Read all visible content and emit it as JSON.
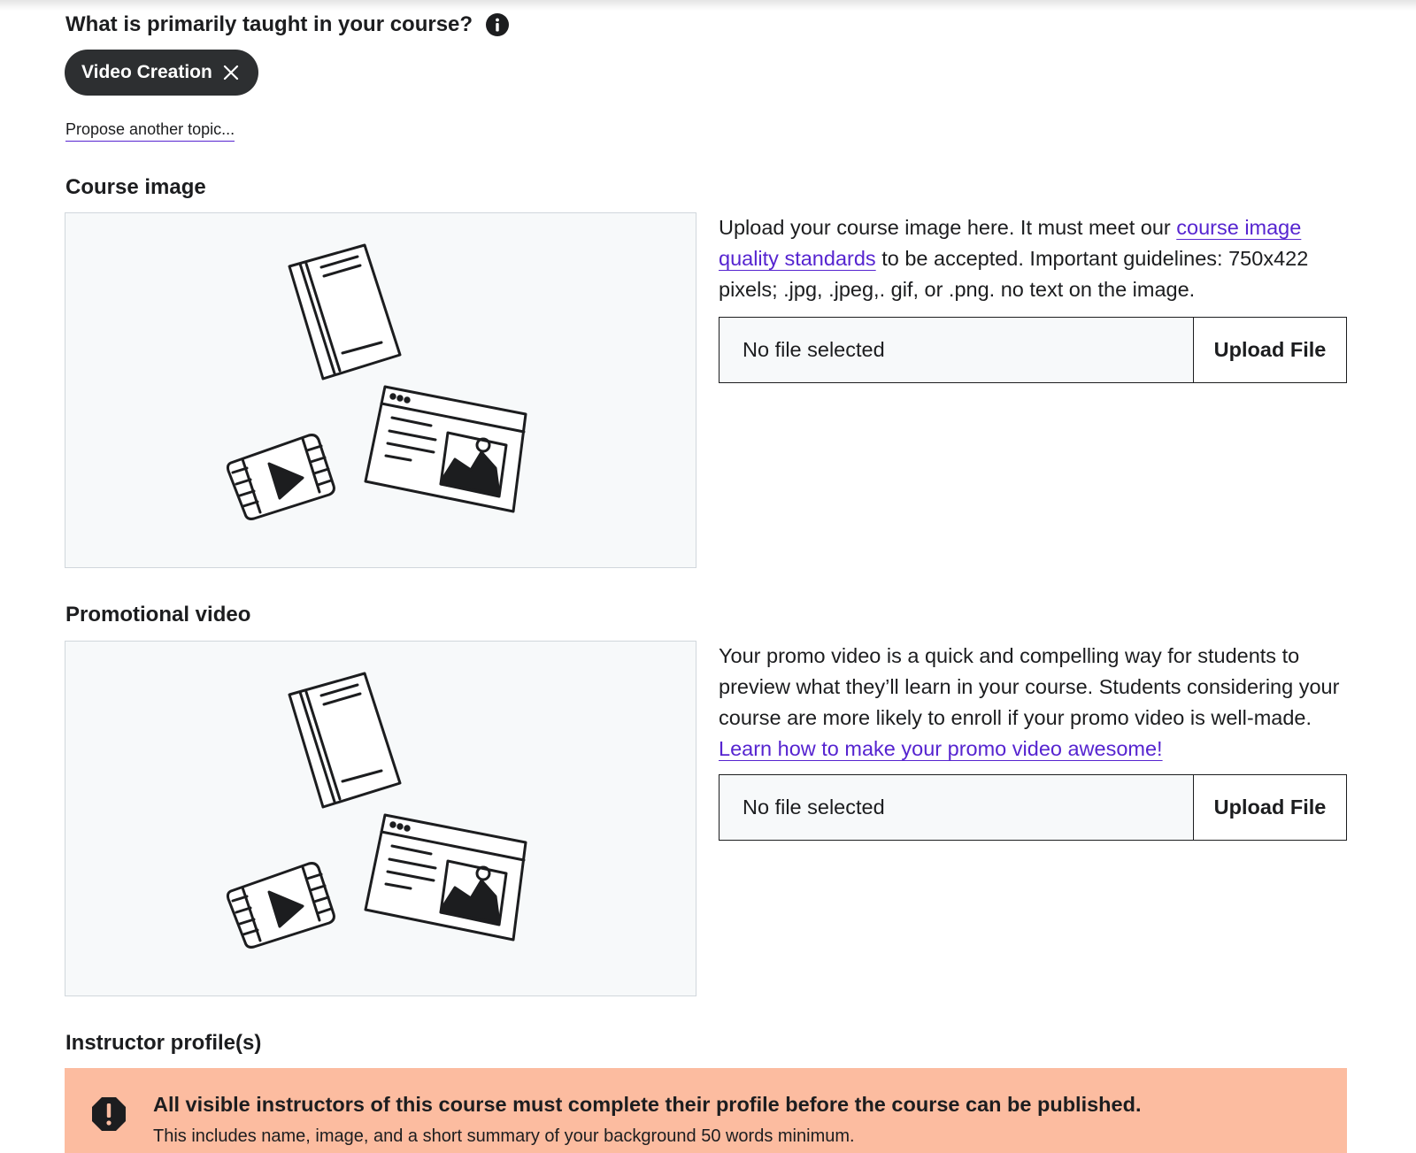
{
  "topic_question": {
    "label": "What is primarily taught in your course?",
    "info_icon": "info-icon",
    "selected_topic": "Video Creation",
    "remove_icon": "close-icon",
    "propose_link": "Propose another topic..."
  },
  "course_image": {
    "label": "Course image",
    "desc_before": "Upload your course image here. It must meet our ",
    "desc_link": "course image quality standards",
    "desc_after": " to be accepted. Important guidelines: 750x422 pixels; .jpg, .jpeg,. gif, or .png. no text on the image.",
    "file_status": "No file selected",
    "upload_label": "Upload File",
    "placeholder_icon": "media-illustration-icon"
  },
  "promo_video": {
    "label": "Promotional video",
    "desc_before": "Your promo video is a quick and compelling way for students to preview what they’ll learn in your course. Students considering your course are more likely to enroll if your promo video is well-made. ",
    "desc_link": "Learn how to make your promo video awesome!",
    "file_status": "No file selected",
    "upload_label": "Upload File",
    "placeholder_icon": "media-illustration-icon"
  },
  "instructor": {
    "label": "Instructor profile(s)",
    "alert_icon": "alert-octagon-icon",
    "alert_title": "All visible instructors of this course must complete their profile before the course can be published.",
    "alert_body": "This includes name, image, and a short summary of your background 50 words minimum.",
    "alert_color": "#fcbca0"
  },
  "colors": {
    "link": "#5624d0",
    "chip_bg": "#2d2f31",
    "text": "#1c1d1f"
  }
}
